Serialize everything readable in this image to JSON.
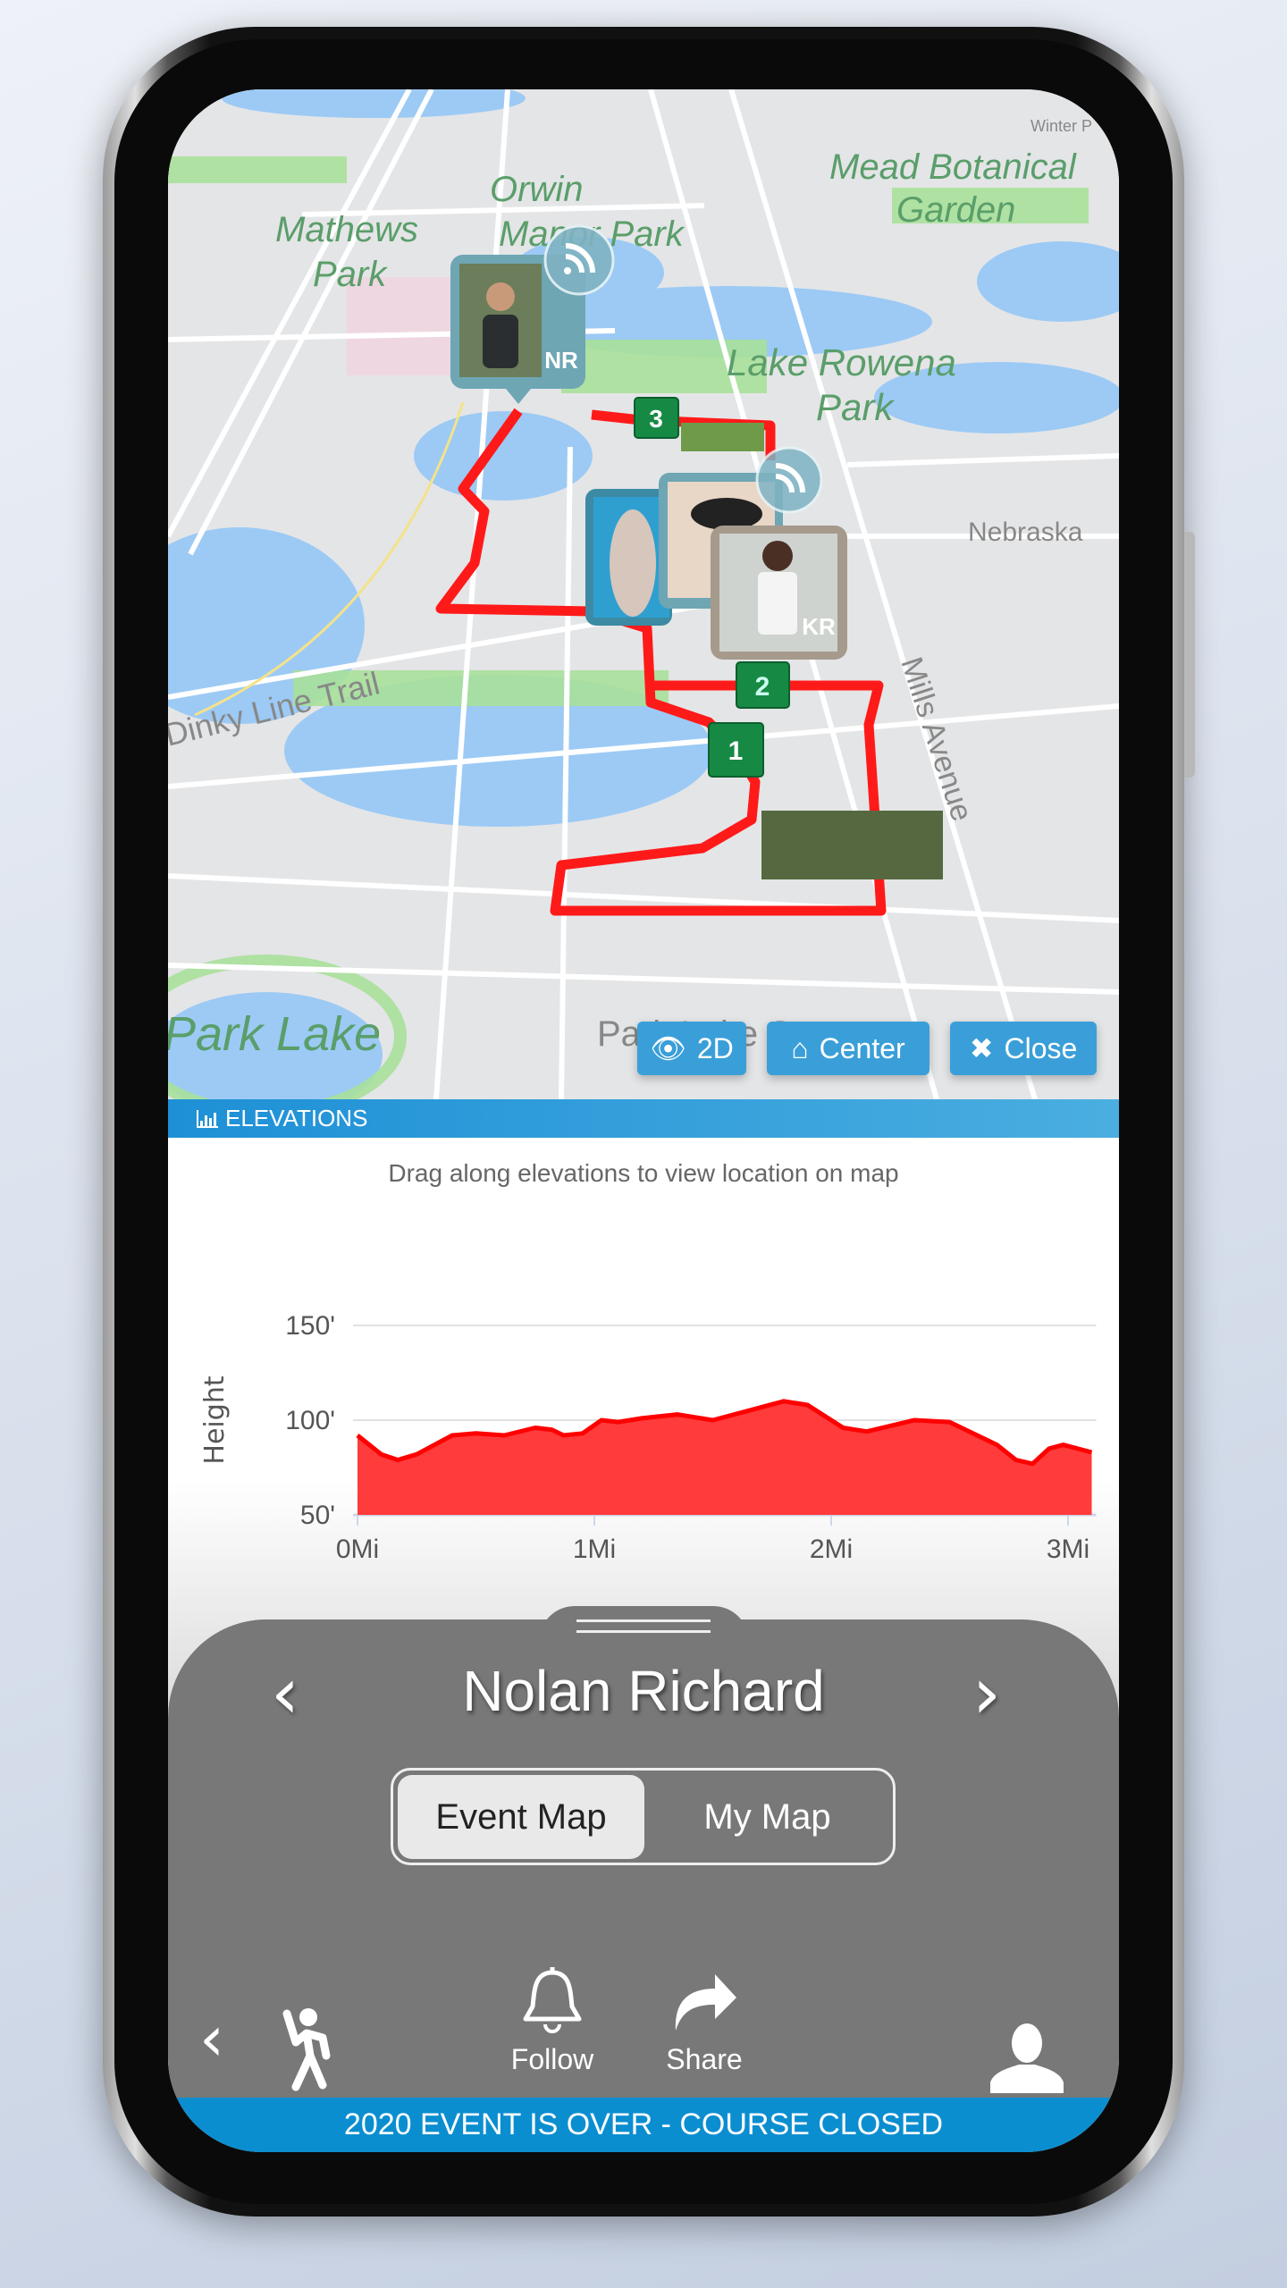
{
  "map": {
    "labels": {
      "orwin": "Orwin",
      "manor_park": "Manor Park",
      "mathews": "Mathews",
      "mathews_park": "Park",
      "mead": "Mead Botanical",
      "garden": "Garden",
      "lake_rowena": "Lake Rowena",
      "rowena_park": "Park",
      "nebraska": "Nebraska",
      "mills": "Mills Avenue",
      "dinky": "Dinky Line Trail",
      "park_lake": "Park Lake",
      "park_lake_st": "Park Lake St",
      "winter": "Winter P"
    },
    "runners": [
      {
        "initials": "NR",
        "live": true
      },
      {
        "initials": "KR",
        "live": true
      }
    ],
    "checkpoints": [
      "1",
      "2",
      "3"
    ],
    "route_color": "#ff1a1a",
    "buttons": {
      "view_2d": "2D",
      "center": "Center",
      "close": "Close"
    }
  },
  "elevations": {
    "header": "ELEVATIONS",
    "hint": "Drag along elevations to view location on map"
  },
  "chart_data": {
    "type": "area",
    "ylabel": "Height",
    "xlabel": "",
    "y_ticks": [
      "150'",
      "100'",
      "50'"
    ],
    "x_ticks": [
      "0Mi",
      "1Mi",
      "2Mi",
      "3Mi"
    ],
    "ylim": [
      50,
      150
    ],
    "xlim": [
      0,
      3.1
    ],
    "grid": true,
    "color": "#ff3b3b",
    "x": [
      0,
      0.1,
      0.17,
      0.25,
      0.4,
      0.5,
      0.62,
      0.75,
      0.82,
      0.87,
      0.95,
      1.03,
      1.1,
      1.2,
      1.35,
      1.5,
      1.65,
      1.8,
      1.9,
      2.05,
      2.15,
      2.35,
      2.5,
      2.7,
      2.78,
      2.85,
      2.92,
      2.98,
      3.1
    ],
    "values": [
      92,
      82,
      79,
      82,
      92,
      93,
      92,
      96,
      95,
      92,
      93,
      100,
      99,
      101,
      103,
      100,
      105,
      110,
      108,
      96,
      94,
      100,
      99,
      87,
      79,
      77,
      85,
      87,
      83
    ]
  },
  "panel": {
    "runner_name": "Nolan Richard",
    "tabs": [
      {
        "label": "Event Map",
        "selected": true
      },
      {
        "label": "My Map",
        "selected": false
      }
    ],
    "toolbar": {
      "follow": "Follow",
      "share": "Share"
    },
    "banner": "2020 EVENT IS OVER - COURSE CLOSED"
  }
}
